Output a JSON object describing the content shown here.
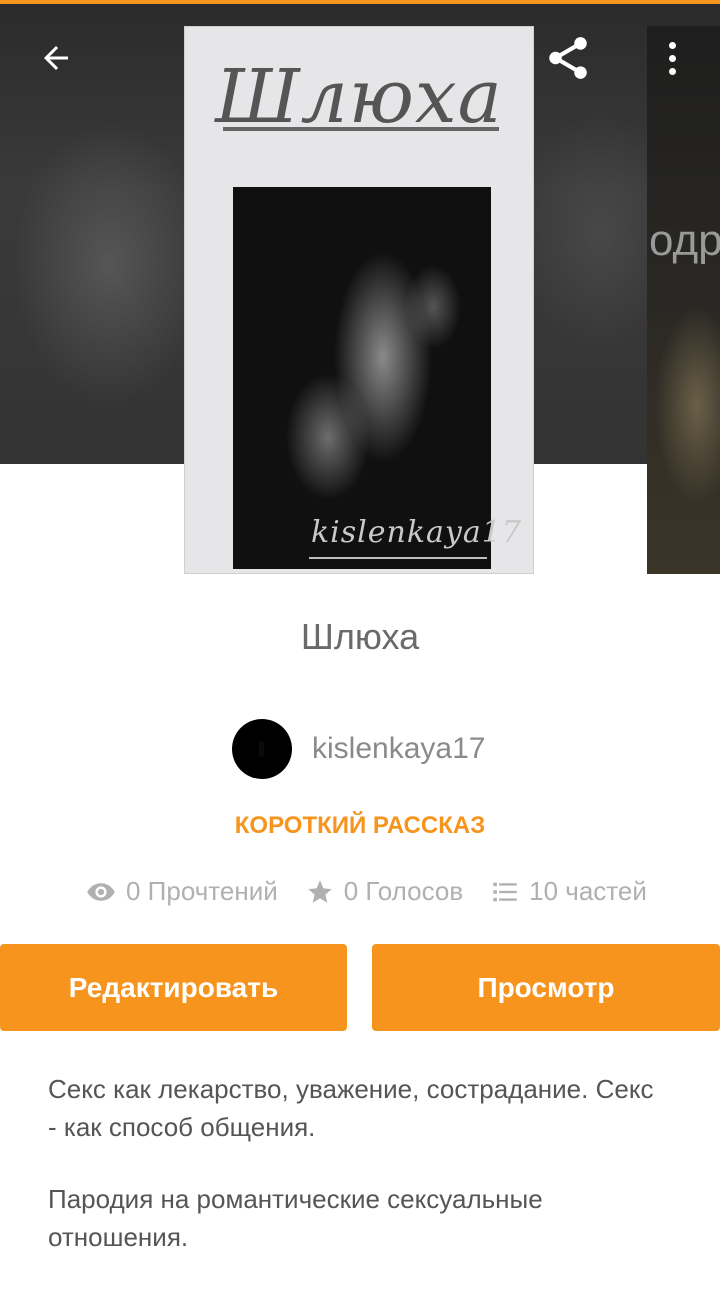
{
  "header": {
    "back_icon": "arrow-left-icon",
    "share_icon": "share-icon",
    "more_icon": "more-vertical-icon"
  },
  "cover": {
    "title": "Шлюха",
    "signature": "kislenkaya17"
  },
  "next_cover": {
    "text_fragment": "одро"
  },
  "story": {
    "title": "Шлюха",
    "author": "kislenkaya17",
    "category": "КОРОТКИЙ РАССКАЗ"
  },
  "stats": {
    "reads": "0 Прочтений",
    "votes": "0 Голосов",
    "parts": "10 частей"
  },
  "actions": {
    "edit_label": "Редактировать",
    "view_label": "Просмотр"
  },
  "description": {
    "paragraph1": "Секс как лекарство, уважение, сострадание. Секс - как способ общения.",
    "paragraph2": "Пародия на романтические сексуальные отношения."
  },
  "colors": {
    "accent": "#f7941d",
    "muted_text": "#b0b0b0"
  }
}
